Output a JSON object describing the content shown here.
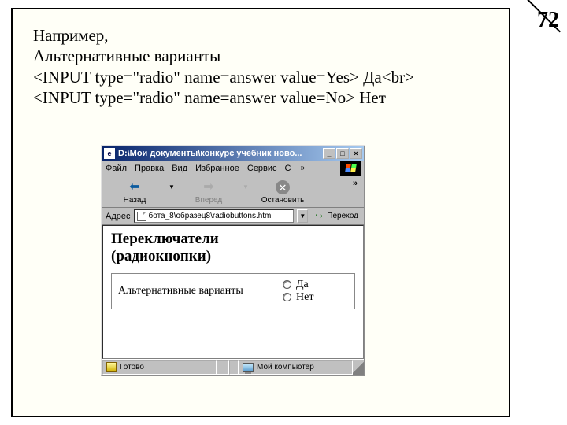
{
  "page_number": "72",
  "text": {
    "l1": "Например,",
    "l2": "Альтернативные варианты",
    "l3": "<INPUT type=\"radio\" name=answer value=Yes> Да<br>",
    "l4": "<INPUT type=\"radio\" name=answer value=No> Нет"
  },
  "browser": {
    "title": "D:\\Мои документы\\конкурс учебник ново...",
    "menu": {
      "file": "Файл",
      "edit": "Правка",
      "view": "Вид",
      "favorites": "Избранное",
      "tools": "Сервис",
      "more": "С",
      "chevron": "»"
    },
    "toolbar": {
      "back": "Назад",
      "forward": "Вперед",
      "stop": "Остановить",
      "chevron": "»"
    },
    "address": {
      "label": "Адрес",
      "value": "бота_8\\образец8\\radiobuttons.htm",
      "go": "Переход"
    },
    "page": {
      "heading_l1": "Переключатели",
      "heading_l2": "(радиокнопки)",
      "left_cell": "Альтернативные варианты",
      "opt_yes": "Да",
      "opt_no": "Нет"
    },
    "status": {
      "ready": "Готово",
      "zone": "Мой компьютер"
    }
  }
}
